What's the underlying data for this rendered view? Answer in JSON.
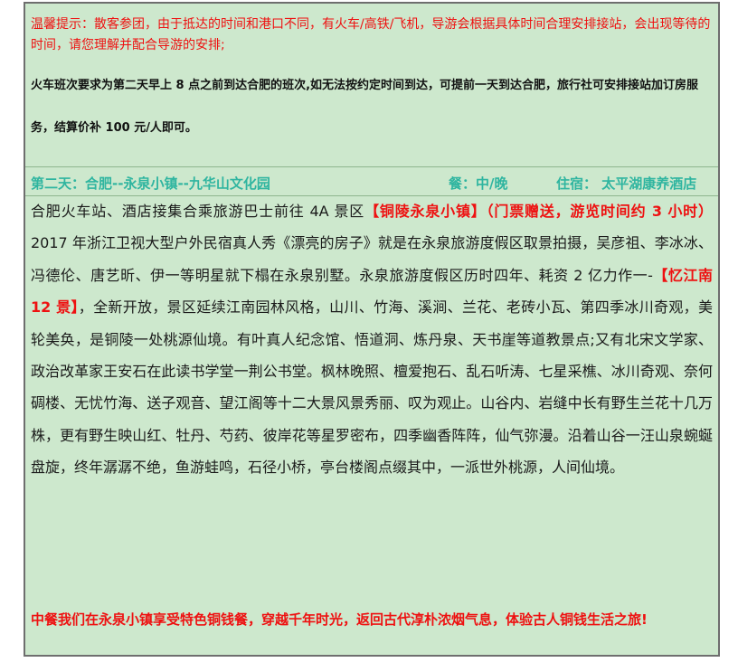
{
  "notice": {
    "label": "温馨提示：",
    "text": "散客参团，由于抵达的时间和港口不同，有火车/高铁/飞机，导游会根据具体时间合理安排接站，会出现等待的时间，请您理解并配合导游的安排;"
  },
  "train_note": "火车班次要求为第二天早上 8 点之前到达合肥的班次,如无法按约定时间到达，可提前一天到达合肥，旅行社可安排接站加订房服务，结算价补 100 元/人即可。",
  "day": {
    "title": "第二天：合肥--永泉小镇--九华山文化园",
    "meals": "餐：中/晚",
    "stay": "住宿：  太平湖康养酒店"
  },
  "body": {
    "part1": "合肥火车站、酒店接集合乘旅游巴士前往 4A 景区",
    "highlight1": "【铜陵永泉小镇】（门票赠送，游览时间约 3 小时）",
    "part2": "  2017 年浙江卫视大型户外民宿真人秀《漂亮的房子》就是在永泉旅游度假区取景拍摄，吴彦祖、李冰冰、冯德伦、唐艺昕、伊一等明星就下榻在永泉别墅。永泉旅游度假区历时四年、耗资 2 亿力作一-",
    "highlight2": "【忆江南 12 景】",
    "part3": "，全新开放，景区延续江南园林风格，山川、竹海、溪涧、兰花、老砖小瓦、第四季冰川奇观，美轮美奂，是铜陵一处桃源仙境。有叶真人纪念馆、悟道洞、炼丹泉、天书崖等道教景点;又有北宋文学家、政治改革家王安石在此读书学堂一荆公书堂。枫林晚照、檀爱抱石、乱石听涛、七星采樵、冰川奇观、奈何碉楼、无忧竹海、送子观音、望江阁等十二大景风景秀丽、叹为观止。山谷内、岩缝中长有野生兰花十几万株，更有野生映山红、牡丹、芍药、彼岸花等星罗密布，四季幽香阵阵，仙气弥漫。沿着山谷一汪山泉蜿蜒盘旋，终年潺潺不绝，鱼游蛙鸣，石径小桥，亭台楼阁点缀其中，一派世外桃源，人间仙境。"
  },
  "closing": "中餐我们在永泉小镇享受特色铜钱餐，穿越千年时光，返回古代淳朴浓烟气息，体验古人铜钱生活之旅!"
}
